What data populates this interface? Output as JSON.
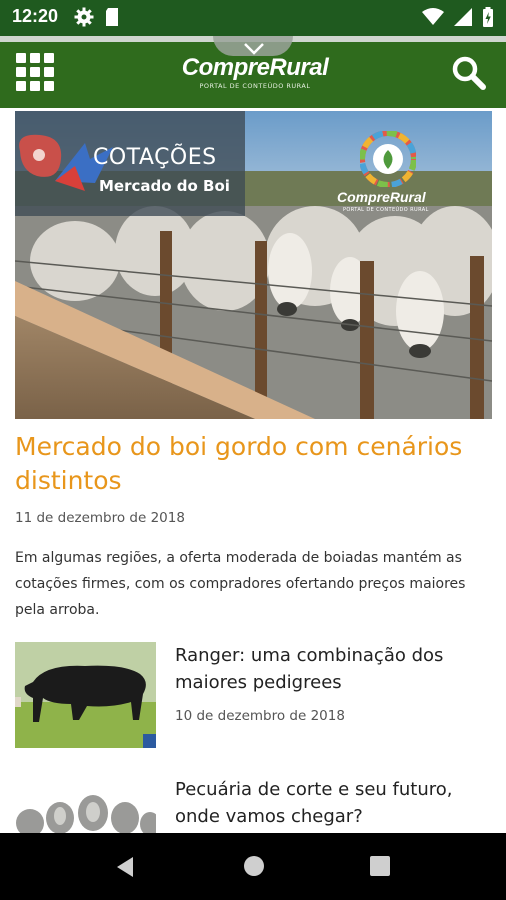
{
  "status_bar": {
    "time": "12:20",
    "left_icons": [
      "gear-icon",
      "sd-card-icon"
    ],
    "right_icons": [
      "wifi-icon",
      "signal-icon",
      "battery-icon"
    ]
  },
  "app_bar": {
    "menu_icon": "grid-menu-icon",
    "logo_text": "CompreRural",
    "logo_subtitle": "PORTAL DE CONTEÚDO RURAL",
    "search_icon": "search-icon",
    "colors": {
      "bar": "#2f6b1d",
      "status": "#1f5a1f"
    }
  },
  "featured": {
    "banner_title": "COTAÇÕES",
    "banner_subtitle": "Mercado do Boi",
    "banner_brand": "CompreRural",
    "banner_brand_sub": "PORTAL DE CONTEÚDO RURAL",
    "headline": "Mercado do boi gordo com cenários distintos",
    "date": "11 de dezembro de 2018",
    "excerpt": "Em algumas regiões, a oferta moderada de boiadas mantém as cotações firmes, com os compradores ofertando preços maiores pela arroba.",
    "accent_color": "#e8961b"
  },
  "articles": [
    {
      "title": "Ranger: uma combinação dos maiores pedigrees",
      "date": "10 de dezembro de 2018"
    },
    {
      "title": "Pecuária de corte e seu futuro, onde vamos chegar?",
      "date": ""
    }
  ],
  "nav_bar": {
    "icons": [
      "back-icon",
      "home-icon",
      "recents-icon"
    ]
  }
}
